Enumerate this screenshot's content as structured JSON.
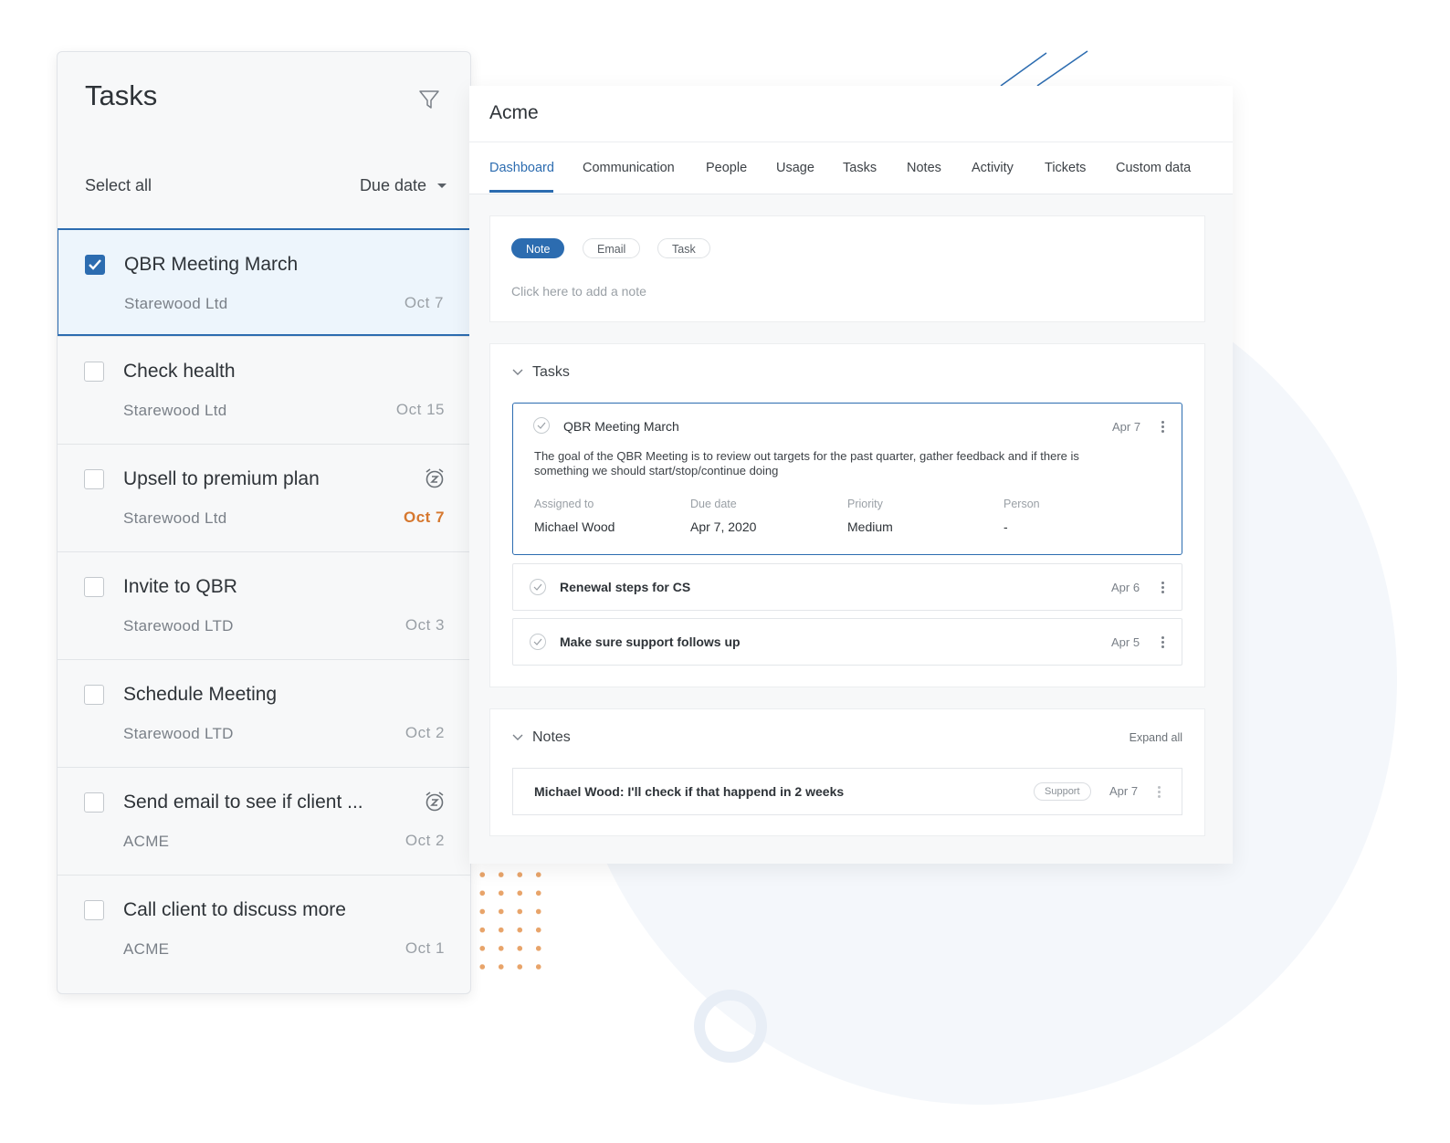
{
  "tasks_panel": {
    "title": "Tasks",
    "select_all": "Select all",
    "sort_label": "Due date",
    "items": [
      {
        "title": "QBR Meeting March",
        "company": "Starewood Ltd",
        "date": "Oct 7",
        "checked": true
      },
      {
        "title": "Check health",
        "company": "Starewood Ltd",
        "date": "Oct 15"
      },
      {
        "title": "Upsell to premium plan",
        "company": "Starewood Ltd",
        "date": "Oct 7",
        "overdue": true,
        "alarm": true
      },
      {
        "title": "Invite to QBR",
        "company": "Starewood LTD",
        "date": "Oct 3"
      },
      {
        "title": "Schedule Meeting",
        "company": "Starewood LTD",
        "date": "Oct 2"
      },
      {
        "title": "Send email to see if client ...",
        "company": "ACME",
        "date": "Oct 2",
        "alarm": true
      },
      {
        "title": "Call client to discuss more",
        "company": "ACME",
        "date": "Oct 1"
      }
    ]
  },
  "account": {
    "name": "Acme",
    "tabs": [
      "Dashboard",
      "Communication",
      "People",
      "Usage",
      "Tasks",
      "Notes",
      "Activity",
      "Tickets",
      "Custom data"
    ],
    "composer": {
      "types": [
        "Note",
        "Email",
        "Task"
      ],
      "placeholder": "Click here to add a note"
    },
    "tasks_section": {
      "title": "Tasks",
      "expanded": {
        "title": "QBR Meeting March",
        "date": "Apr 7",
        "description": "The goal of the QBR Meeting is to review out targets for the past quarter, gather feedback and if there is something we should start/stop/continue doing",
        "meta": [
          {
            "label": "Assigned to",
            "value": "Michael Wood"
          },
          {
            "label": "Due date",
            "value": "Apr 7, 2020"
          },
          {
            "label": "Priority",
            "value": "Medium"
          },
          {
            "label": "Person",
            "value": "-"
          }
        ]
      },
      "rows": [
        {
          "title": "Renewal steps for CS",
          "date": "Apr 6"
        },
        {
          "title": "Make sure support follows up",
          "date": "Apr 5"
        }
      ]
    },
    "notes_section": {
      "title": "Notes",
      "expand_all": "Expand all",
      "note": {
        "text": "Michael Wood: I'll check if that happend in 2 weeks",
        "tag": "Support",
        "date": "Apr 7"
      }
    }
  },
  "colors": {
    "accent": "#2c6cb0",
    "overdue": "#d6782f",
    "dots": "#e8a46a"
  }
}
